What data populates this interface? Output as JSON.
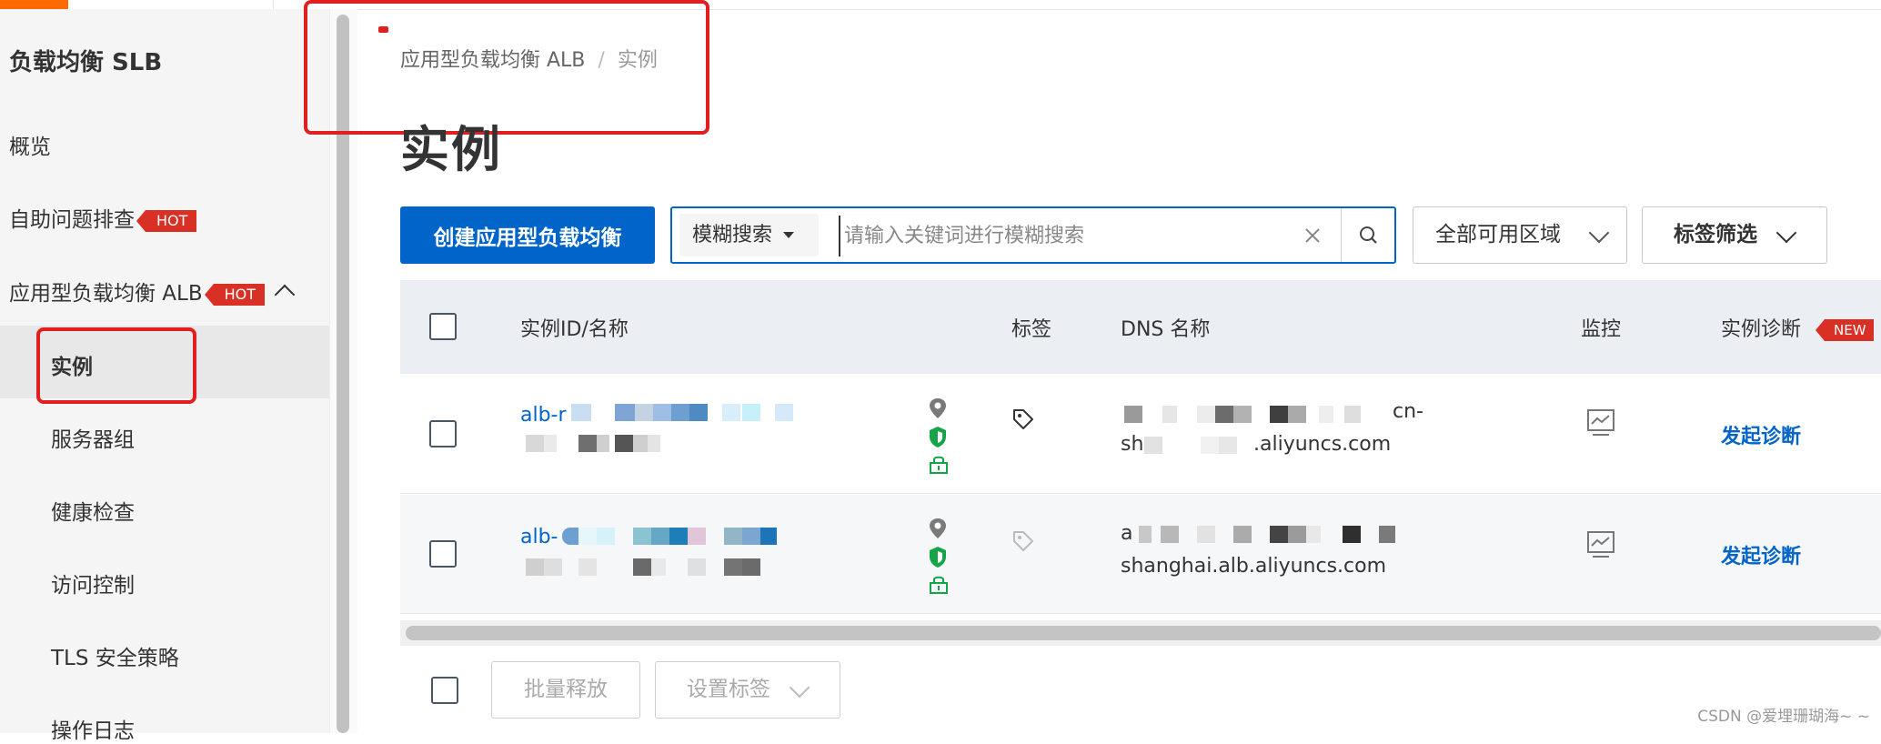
{
  "sidebar": {
    "title": "负载均衡 SLB",
    "items": [
      {
        "label": "概览"
      },
      {
        "label": "自助问题排查",
        "badge": "HOT"
      },
      {
        "label": "应用型负载均衡 ALB",
        "badge": "HOT"
      }
    ],
    "sub_items": [
      {
        "label": "实例",
        "active": true
      },
      {
        "label": "服务器组"
      },
      {
        "label": "健康检查"
      },
      {
        "label": "访问控制"
      },
      {
        "label": "TLS 安全策略"
      },
      {
        "label": "操作日志"
      }
    ]
  },
  "breadcrumb": {
    "parent": "应用型负载均衡 ALB",
    "separator": "/",
    "current": "实例"
  },
  "page_title": "实例",
  "toolbar": {
    "create_button": "创建应用型负载均衡",
    "search_mode": "模糊搜索",
    "search_placeholder": "请输入关键词进行模糊搜索",
    "zone_select": "全部可用区域",
    "tag_filter": "标签筛选"
  },
  "table": {
    "columns": {
      "id_name": "实例ID/名称",
      "tags": "标签",
      "dns": "DNS 名称",
      "monitor": "监控",
      "diagnose": "实例诊断",
      "diagnose_badge": "NEW"
    },
    "rows": [
      {
        "id_prefix": "alb-r",
        "dns_line1_suffix": "cn-",
        "dns_line2_prefix": "sh",
        "dns_line2_suffix": ".aliyuncs.com",
        "action": "发起诊断"
      },
      {
        "id_prefix": "alb-",
        "dns_line1_prefix": "a",
        "dns_line2": "shanghai.alb.aliyuncs.com",
        "action": "发起诊断"
      }
    ]
  },
  "footer": {
    "release_button": "批量释放",
    "tag_button": "设置标签"
  },
  "watermark": "CSDN @爱埋珊瑚海~ ~",
  "colors": {
    "primary": "#0064c8",
    "hot_badge": "#d93026",
    "annotation_red": "#e02020",
    "shield_green": "#16a34a"
  }
}
